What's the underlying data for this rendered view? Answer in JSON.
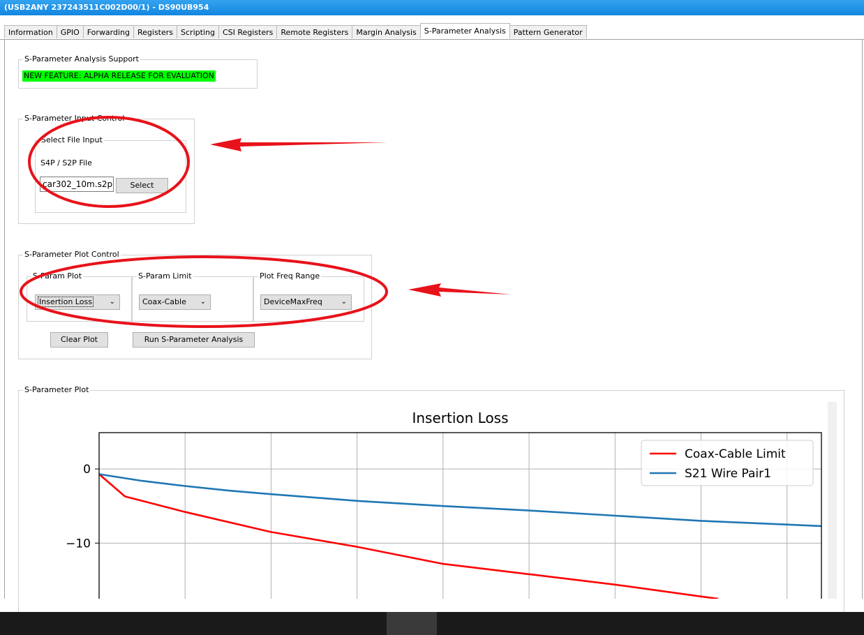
{
  "window": {
    "title": "(USB2ANY 237243511C002D00/1) - DS90UB954"
  },
  "tabs": [
    {
      "label": "Information"
    },
    {
      "label": "GPIO"
    },
    {
      "label": "Forwarding"
    },
    {
      "label": "Registers"
    },
    {
      "label": "Scripting"
    },
    {
      "label": "CSI Registers"
    },
    {
      "label": "Remote Registers"
    },
    {
      "label": "Margin Analysis"
    },
    {
      "label": "S-Parameter Analysis",
      "active": true
    },
    {
      "label": "Pattern Generator"
    }
  ],
  "support": {
    "legend": "S-Parameter Analysis Support",
    "banner": "NEW FEATURE: ALPHA RELEASE FOR EVALUATION",
    "banner_color": "#00ff00"
  },
  "input_control": {
    "legend": "S-Parameter Input Control",
    "file_group_legend": "Select File Input",
    "file_label": "S4P / S2P File",
    "file_value": "car302_10m.s2p",
    "select_label": "Select"
  },
  "plot_control": {
    "legend": "S-Parameter Plot Control",
    "plot_legend": "S-Param Plot",
    "plot_value": "Insertion Loss",
    "limit_legend": "S-Param Limit",
    "limit_value": "Coax-Cable",
    "range_legend": "Plot Freq Range",
    "range_value": "DeviceMaxFreq",
    "clear_label": "Clear Plot",
    "run_label": "Run S-Parameter Analysis"
  },
  "plot_section": {
    "legend": "S-Parameter Plot"
  },
  "annotation_color": "#e8121a",
  "chart_data": {
    "type": "line",
    "title": "Insertion Loss",
    "xlabel": "",
    "ylabel": "",
    "xlim": [
      0,
      8.4
    ],
    "ylim": [
      -17.5,
      4.9
    ],
    "yticks": [
      0,
      -10
    ],
    "ytick_labels": [
      "0",
      "−10"
    ],
    "xgrid": [
      1,
      2,
      3,
      4,
      5,
      6,
      7,
      8
    ],
    "grid": true,
    "legend_position": "top-right",
    "series": [
      {
        "name": "Coax-Cable Limit",
        "color": "#ff0000",
        "x": [
          0,
          0.3,
          1,
          2,
          3,
          4,
          5,
          6,
          7,
          7.2
        ],
        "y": [
          -0.7,
          -3.7,
          -5.8,
          -8.5,
          -10.5,
          -12.8,
          -14.2,
          -15.6,
          -17.2,
          -17.5
        ]
      },
      {
        "name": "S21 Wire Pair1",
        "color": "#1f77b4",
        "x": [
          0,
          0.5,
          1,
          1.5,
          2,
          3,
          4,
          5,
          6,
          7,
          8.4
        ],
        "y": [
          -0.7,
          -1.6,
          -2.3,
          -2.9,
          -3.4,
          -4.3,
          -5.0,
          -5.6,
          -6.3,
          -7.0,
          -7.7
        ]
      }
    ]
  }
}
